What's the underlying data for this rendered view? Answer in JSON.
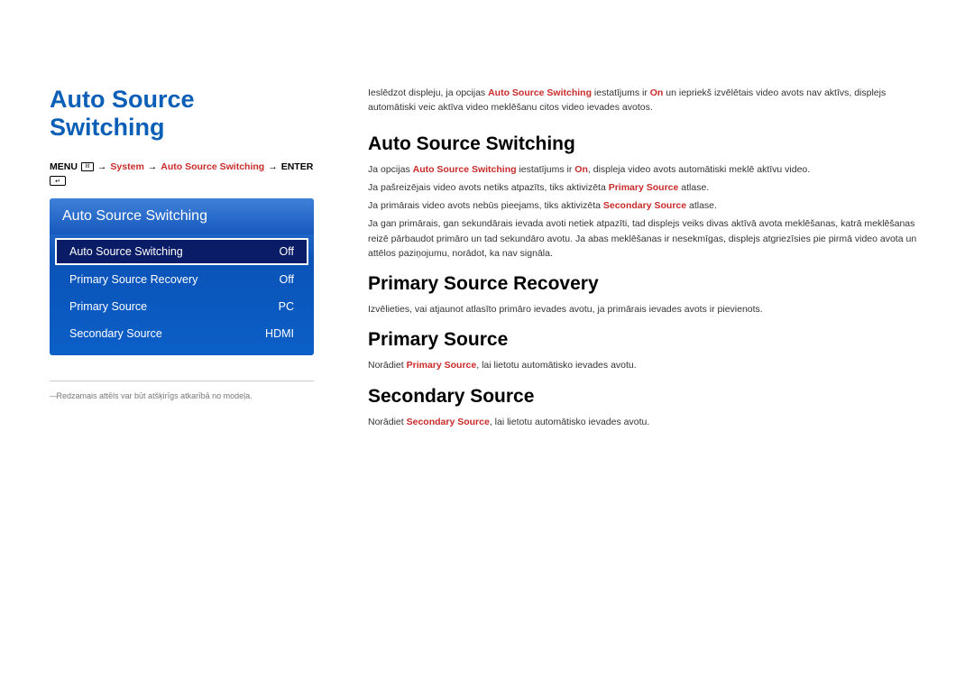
{
  "left": {
    "title": "Auto Source Switching",
    "breadcrumb": {
      "menu": "MENU",
      "system": "System",
      "page": "Auto Source Switching",
      "enter": "ENTER"
    },
    "panel": {
      "header": "Auto Source Switching",
      "rows": [
        {
          "label": "Auto Source Switching",
          "value": "Off",
          "selected": true
        },
        {
          "label": "Primary Source Recovery",
          "value": "Off",
          "selected": false
        },
        {
          "label": "Primary Source",
          "value": "PC",
          "selected": false
        },
        {
          "label": "Secondary Source",
          "value": "HDMI",
          "selected": false
        }
      ]
    },
    "footnote": "Redzamais attēls var būt atšķirīgs atkarībā no modeļa."
  },
  "right": {
    "intro": {
      "pre": "Ieslēdzot displeju, ja opcijas ",
      "bold1": "Auto Source Switching",
      "mid1": " iestatījums ir ",
      "bold2": "On",
      "post": " un iepriekš izvēlētais video avots nav aktīvs, displejs automātiski veic aktīva video meklēšanu citos video ievades avotos."
    },
    "sections": [
      {
        "heading": "Auto Source Switching",
        "paragraphs": [
          {
            "parts": [
              {
                "t": "Ja opcijas "
              },
              {
                "t": "Auto Source Switching",
                "red": true
              },
              {
                "t": " iestatījums ir "
              },
              {
                "t": "On",
                "red": true
              },
              {
                "t": ", displeja video avots automātiski meklē aktīvu video."
              }
            ]
          },
          {
            "parts": [
              {
                "t": "Ja pašreizējais video avots netiks atpazīts, tiks aktivizēta "
              },
              {
                "t": "Primary Source",
                "red": true
              },
              {
                "t": " atlase."
              }
            ]
          },
          {
            "parts": [
              {
                "t": "Ja primārais video avots nebūs pieejams, tiks aktivizēta "
              },
              {
                "t": "Secondary Source",
                "red": true
              },
              {
                "t": " atlase."
              }
            ]
          },
          {
            "parts": [
              {
                "t": "Ja gan primārais, gan sekundārais ievada avoti netiek atpazīti, tad displejs veiks divas aktīvā avota meklēšanas, katrā meklēšanas reizē pārbaudot primāro un tad sekundāro avotu. Ja abas meklēšanas ir nesekmīgas, displejs atgriezīsies pie pirmā video avota un attēlos paziņojumu, norādot, ka nav signāla."
              }
            ]
          }
        ]
      },
      {
        "heading": "Primary Source Recovery",
        "paragraphs": [
          {
            "parts": [
              {
                "t": "Izvēlieties, vai atjaunot atlasīto primāro ievades avotu, ja primārais ievades avots ir pievienots."
              }
            ]
          }
        ]
      },
      {
        "heading": "Primary Source",
        "paragraphs": [
          {
            "parts": [
              {
                "t": "Norādiet "
              },
              {
                "t": "Primary Source",
                "red": true
              },
              {
                "t": ", lai lietotu automātisko ievades avotu."
              }
            ]
          }
        ]
      },
      {
        "heading": "Secondary Source",
        "paragraphs": [
          {
            "parts": [
              {
                "t": "Norādiet "
              },
              {
                "t": "Secondary Source",
                "red": true
              },
              {
                "t": ", lai lietotu automātisko ievades avotu."
              }
            ]
          }
        ]
      }
    ]
  }
}
